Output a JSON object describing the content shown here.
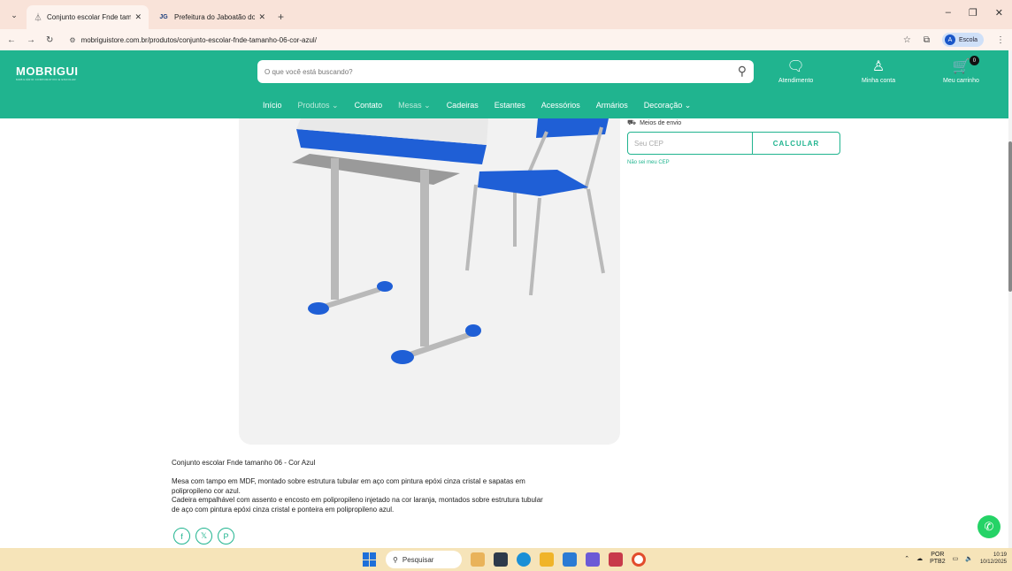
{
  "browser": {
    "tabs": [
      {
        "label": "Conjunto escolar Fnde tamanho",
        "active": true
      },
      {
        "label": "Prefeitura do Jaboatão dos Gua",
        "active": false
      }
    ],
    "url": "mobriguistore.com.br/produtos/conjunto-escolar-fnde-tamanho-06-cor-azul/",
    "profile_label": "Escola",
    "profile_initial": "A"
  },
  "header": {
    "logo": "MOBRIGUI",
    "logo_tagline": "MOBILIÁRIO CORPORATIVO E ESCOLAR",
    "search_placeholder": "O que você está buscando?",
    "service_label": "Atendimento",
    "account_label": "Minha conta",
    "cart_label": "Meu carrinho",
    "cart_count": "0"
  },
  "menu": [
    {
      "label": "Início",
      "dim": false
    },
    {
      "label": "Produtos ⌄",
      "dim": true
    },
    {
      "label": "Contato",
      "dim": false
    },
    {
      "label": "Mesas ⌄",
      "dim": true
    },
    {
      "label": "Cadeiras",
      "dim": false
    },
    {
      "label": "Estantes",
      "dim": false
    },
    {
      "label": "Acessórios",
      "dim": false
    },
    {
      "label": "Armários",
      "dim": false
    },
    {
      "label": "Decoração ⌄",
      "dim": false
    }
  ],
  "shipping": {
    "title": "Meios de envio",
    "cep_placeholder": "Seu CEP",
    "calc_button": "CALCULAR",
    "unknown_cep_link": "Não sei meu CEP"
  },
  "product": {
    "title": "Conjunto escolar Fnde tamanho 06 - Cor Azul",
    "description": [
      "Mesa com tampo em MDF, montado sobre estrutura tubular em aço com pintura epóxi cinza cristal e sapatas em",
      "polipropileno cor azul.",
      "Cadeira empalhável com assento e encosto em polipropileno injetado na cor laranja, montados sobre estrutura tubular",
      "de aço com pintura epóxi cinza cristal e ponteira em polipropileno azul."
    ]
  },
  "taskbar": {
    "search_label": "Pesquisar",
    "lang_line1": "POR",
    "lang_line2": "PTB2",
    "time": "10:19",
    "date": "10/12/2025"
  },
  "colors": {
    "brand": "#20b48f",
    "blue": "#1f5fd6"
  }
}
